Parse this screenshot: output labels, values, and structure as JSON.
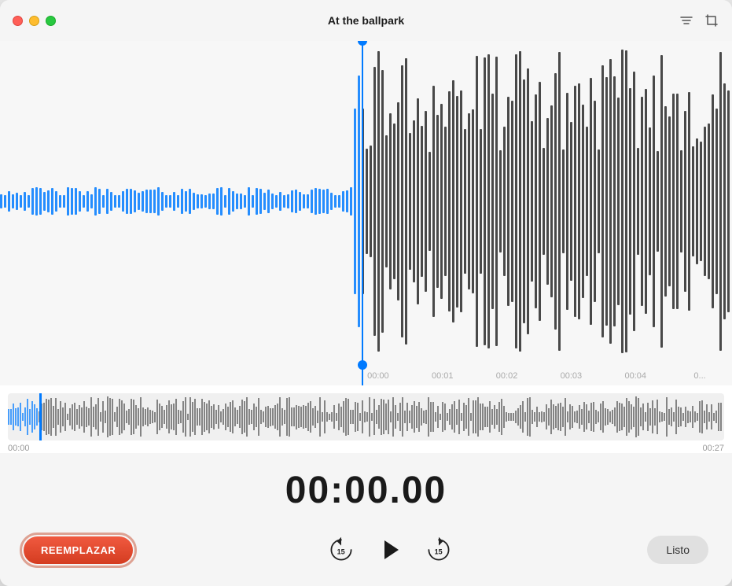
{
  "titlebar": {
    "title": "At the ballpark",
    "traffic_lights": [
      "close",
      "minimize",
      "maximize"
    ],
    "icons": [
      "filter-icon",
      "crop-icon"
    ]
  },
  "waveform": {
    "playhead_position_percent": 0,
    "detail_timeline": [
      "00:00",
      "00:01",
      "00:02",
      "00:03",
      "00:04"
    ],
    "overview_start": "00:00",
    "overview_end": "00:27"
  },
  "time_display": {
    "value": "00:00.00"
  },
  "controls": {
    "replace_label": "REEMPLAZAR",
    "skip_back_label": "15",
    "skip_forward_label": "15",
    "play_label": "▶",
    "done_label": "Listo"
  }
}
